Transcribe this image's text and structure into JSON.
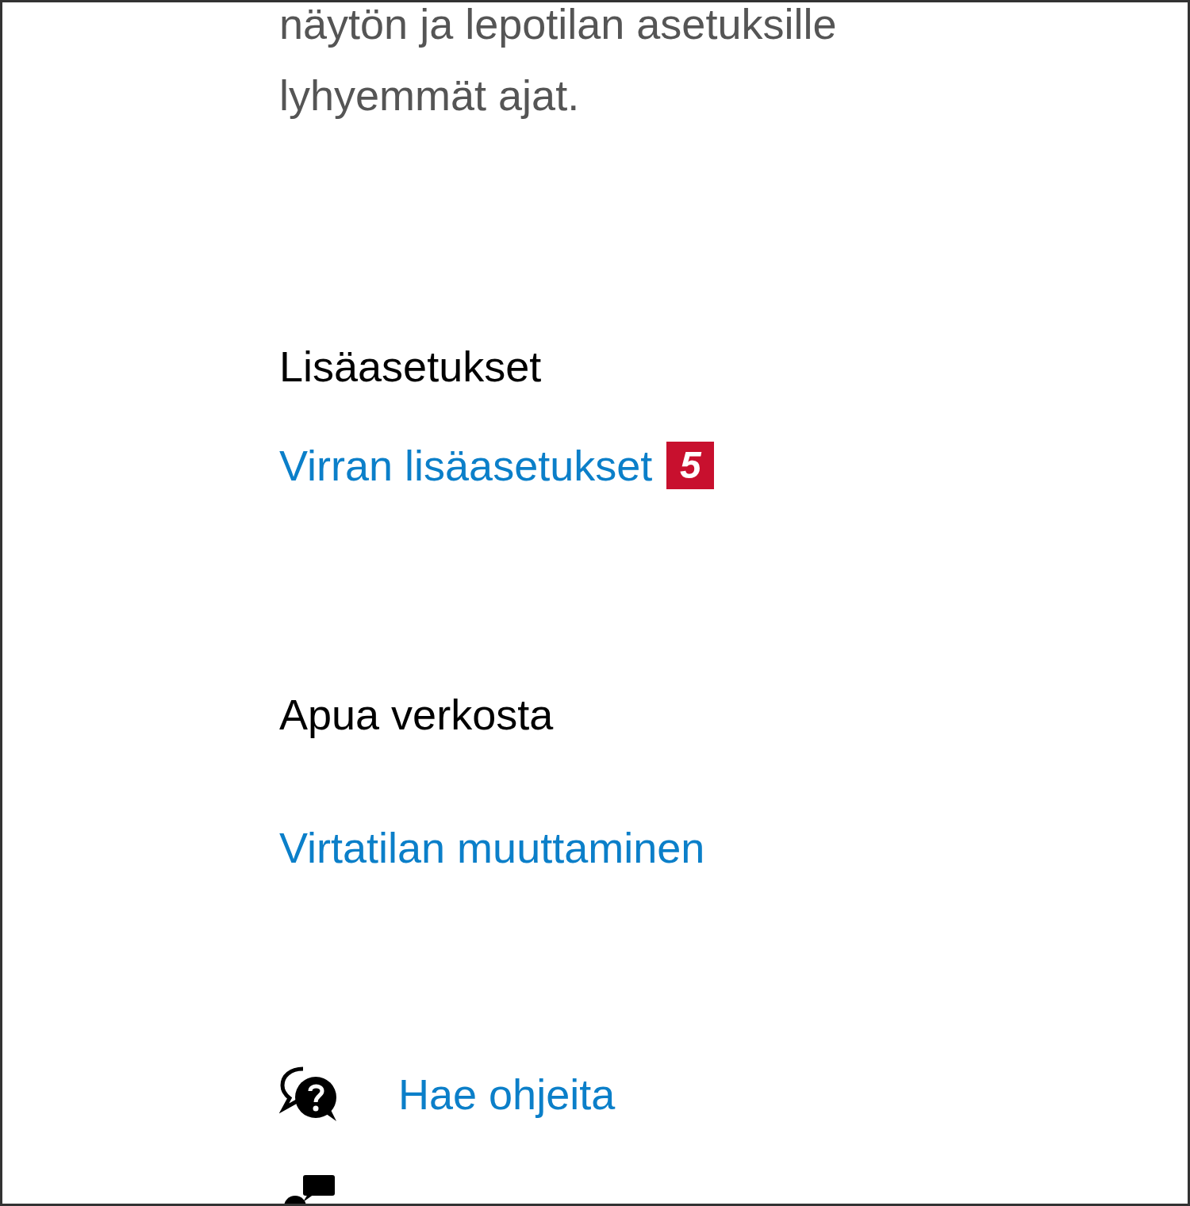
{
  "description": "näytön ja lepotilan asetuksille lyhyemmät ajat.",
  "sections": [
    {
      "heading": "Lisäasetukset",
      "links": [
        {
          "label": "Virran lisäasetukset",
          "badge": "5"
        }
      ]
    },
    {
      "heading": "Apua verkosta",
      "links": [
        {
          "label": "Virtatilan muuttaminen"
        }
      ]
    }
  ],
  "help_links": [
    {
      "kind": "help",
      "label": "Hae ohjeita"
    },
    {
      "kind": "feedback"
    }
  ]
}
